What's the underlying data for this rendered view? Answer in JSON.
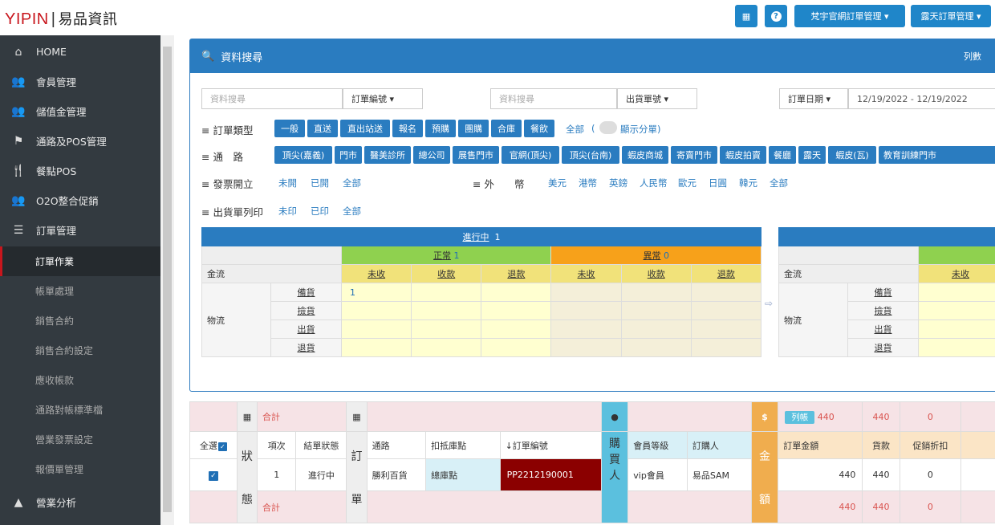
{
  "header": {
    "logo_latin": "YIPIN",
    "logo_cn": "易品資訊",
    "btn_menu_a": "梵宇官網訂單管理 ▾",
    "btn_menu_b": "露天訂單管理 ▾",
    "grid_icon": "grid-icon",
    "help_icon": "question-icon"
  },
  "sidebar": {
    "items": [
      {
        "label": "HOME",
        "icon": "home-icon"
      },
      {
        "label": "會員管理",
        "icon": "users-icon"
      },
      {
        "label": "儲值金管理",
        "icon": "users-icon"
      },
      {
        "label": "通路及POS管理",
        "icon": "flag-icon"
      },
      {
        "label": "餐點POS",
        "icon": "cutlery-icon"
      },
      {
        "label": "O2O整合促銷",
        "icon": "users-icon"
      },
      {
        "label": "訂單管理",
        "icon": "list-icon"
      }
    ],
    "subitems": [
      "訂單作業",
      "帳單處理",
      "銷售合約",
      "銷售合約設定",
      "應收帳款",
      "通路對帳標準檔",
      "營業發票設定",
      "報價單管理"
    ],
    "bottom": {
      "label": "營業分析",
      "icon": "chart-icon"
    }
  },
  "search": {
    "title": "資料搜尋",
    "cols_label": "列數",
    "placeholder1": "資料搜尋",
    "dd1": "訂單編號 ▾",
    "placeholder2": "資料搜尋",
    "dd2": "出貨單號 ▾",
    "date_dd": "訂單日期 ▾",
    "date_value": "12/19/2022 - 12/19/2022",
    "order_type_label": "≡ 訂單類型",
    "order_types": [
      "一般",
      "直送",
      "直出站送",
      "報名",
      "預購",
      "團購",
      "合庫",
      "餐飲"
    ],
    "order_type_all": "全部",
    "toggle_label": "顯示分單)",
    "toggle_open": "(",
    "channel_label": "≡ 通　路",
    "channels": [
      "頂尖(嘉義)",
      "門市",
      "醫美診所",
      "總公司",
      "展售門市",
      "官網(頂尖)",
      "頂尖(台南)",
      "蝦皮商城",
      "寄賣門市",
      "蝦皮拍賣",
      "餐廳",
      "露天",
      "蝦皮(瓦)",
      "教育訓練門市"
    ],
    "invoice_label": "≡ 發票開立",
    "invoice_opts": [
      "未開",
      "已開",
      "全部"
    ],
    "currency_label": "≡ 外　　幣",
    "currency_opts": [
      "美元",
      "港幣",
      "英鎊",
      "人民幣",
      "歐元",
      "日圓",
      "韓元",
      "全部"
    ],
    "print_label": "≡ 出貨單列印",
    "print_opts": [
      "未印",
      "已印",
      "全部"
    ]
  },
  "status_table": {
    "title": "進行中",
    "title_count": "1",
    "normal": "正常",
    "normal_count": "1",
    "abnormal": "異常",
    "abnormal_count": "0",
    "cash": "金流",
    "cash_cols": [
      "未收",
      "收款",
      "退款",
      "未收",
      "收款",
      "退款"
    ],
    "logistics": "物流",
    "logistics_rows": [
      "備貨",
      "撿貨",
      "出貨",
      "退貨"
    ],
    "cell_value": "1"
  },
  "right_table": {
    "cash": "金流",
    "col": "未收",
    "logistics": "物流",
    "rows": [
      "備貨",
      "撿貨",
      "出貨",
      "退貨"
    ]
  },
  "orders": {
    "total_label": "合計",
    "all_select": "全選",
    "status_vert": [
      "狀",
      "態"
    ],
    "order_vert": [
      "訂",
      "單"
    ],
    "buyer_vert": [
      "購",
      "買",
      "人"
    ],
    "amount_vert": [
      "金",
      "額"
    ],
    "col_seq": "項次",
    "col_settle": "結單狀態",
    "col_channel": "通路",
    "col_warehouse": "扣抵庫點",
    "col_order_no": "↓訂單編號",
    "col_level": "會員等級",
    "col_buyer": "訂購人",
    "col_amount": "訂單金額",
    "col_paid": "貨款",
    "col_discount": "促銷折扣",
    "list_btn": "列帳",
    "sum_top": [
      "440",
      "440",
      "0"
    ],
    "row": {
      "seq": "1",
      "settle": "進行中",
      "channel": "勝利百貨",
      "warehouse": "總庫點",
      "order_no": "PP2212190001",
      "level": "vip會員",
      "buyer": "易品SAM",
      "amount": "440",
      "paid": "440",
      "discount": "0"
    },
    "sum_bottom": [
      "440",
      "440",
      "0"
    ]
  }
}
